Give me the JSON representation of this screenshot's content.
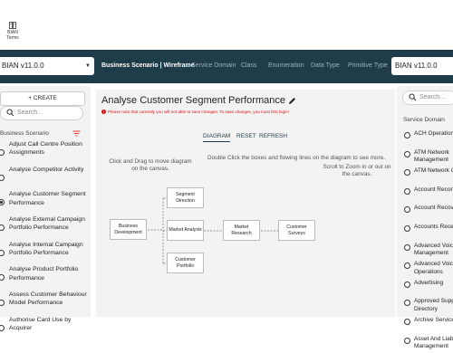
{
  "topbar": {
    "terms_line1": "BIAN",
    "terms_line2": "Terms"
  },
  "navbar": {
    "version_left": "BIAN v11.0.0",
    "version_right": "BIAN v11.0.0",
    "items": [
      "Business Scenario | Wireframe",
      "Service Domain",
      "Class",
      "Enumeration",
      "Data Type",
      "Primitive Type"
    ]
  },
  "left": {
    "create_label": "CREATE",
    "search_placeholder": "Search...",
    "section_title": "Business Scenario",
    "items": [
      {
        "label": "Adjust Call Centre Position Assignments",
        "selected": false
      },
      {
        "label": "Analyse Competitor Activity",
        "selected": false
      },
      {
        "label": "Analyse Customer Segment Performance",
        "selected": true
      },
      {
        "label": "Analyse External Campaign Portfolio Performance",
        "selected": false
      },
      {
        "label": "Analyse Internal Campaign Portfolio Performance",
        "selected": false
      },
      {
        "label": "Analyse Product Portfolio Performance",
        "selected": false
      },
      {
        "label": "Assess Customer Behaviour Model Performance",
        "selected": false
      },
      {
        "label": "Authorise Card Use by Acquirer",
        "selected": false
      }
    ]
  },
  "main": {
    "title": "Analyse Customer Segment Performance",
    "warning": "Please note that currently you will not able to save changes. To save changes, you must first login!",
    "tabs": [
      "DIAGRAM",
      "RESET",
      "REFRESH"
    ],
    "hint_left": "Click and Drag to move diagram on the canvas.",
    "hint_mid": "Double Click the boxes and flowing lines on the diagram to see more.",
    "hint_right": "Scroll to Zoom in or out on the canvas.",
    "nodes": {
      "business_development": "Business Development",
      "segment_direction": "Segment Direction",
      "market_analysis": "Market Analysis",
      "customer_portfolio": "Customer Portfolio",
      "market_research": "Market Research",
      "customer_surveys": "Customer Surveys"
    }
  },
  "right": {
    "search_placeholder": "Search...",
    "section_title": "Service Domain",
    "items": [
      "ACH Operation",
      "ATM Network Management",
      "ATM Network C",
      "Account Recon",
      "Account Recov",
      "Accounts Rece",
      "Advanced Voice Management",
      "Advanced Voice Operations",
      "Advertising",
      "Approved Supp Directory",
      "Archive Service",
      "Asset And Liabi Management"
    ]
  },
  "colors": {
    "navbar": "#1f3c4a",
    "warning": "#dd1111"
  }
}
